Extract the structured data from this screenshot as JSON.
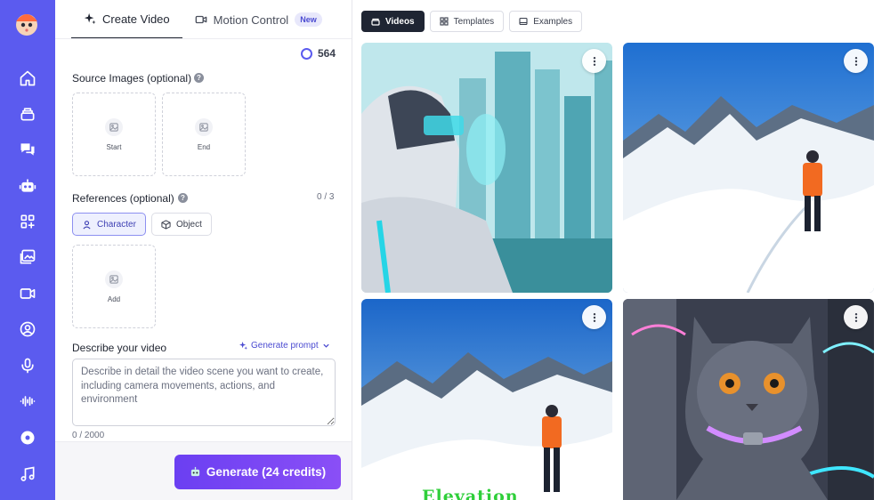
{
  "rail": {
    "icons": [
      "logo-avatar-icon",
      "home-icon",
      "layers-icon",
      "chat-icon",
      "robot-icon",
      "apps-icon",
      "gallery-icon",
      "video-icon",
      "profile-icon",
      "microphone-icon",
      "soundwave-icon",
      "disc-icon",
      "music-icon"
    ]
  },
  "tabs": {
    "create": "Create Video",
    "motion": "Motion Control",
    "motion_badge": "New"
  },
  "credits": "564",
  "source_images": {
    "label": "Source Images (optional)",
    "start": "Start",
    "end": "End"
  },
  "references": {
    "label": "References (optional)",
    "counter": "0 / 3",
    "character": "Character",
    "object": "Object",
    "add": "Add"
  },
  "describe": {
    "label": "Describe your video",
    "generate_prompt": "Generate prompt",
    "placeholder": "Describe in detail the video scene you want to create, including camera movements, actions, and environment",
    "counter": "0 / 2000"
  },
  "generate_button": "Generate (24 credits)",
  "gallery": {
    "tabs": [
      "Videos",
      "Templates",
      "Examples"
    ],
    "overlay_text": "Elevation",
    "colors": {
      "accent": "#5b5bef",
      "generate": "#7c47f4"
    }
  }
}
